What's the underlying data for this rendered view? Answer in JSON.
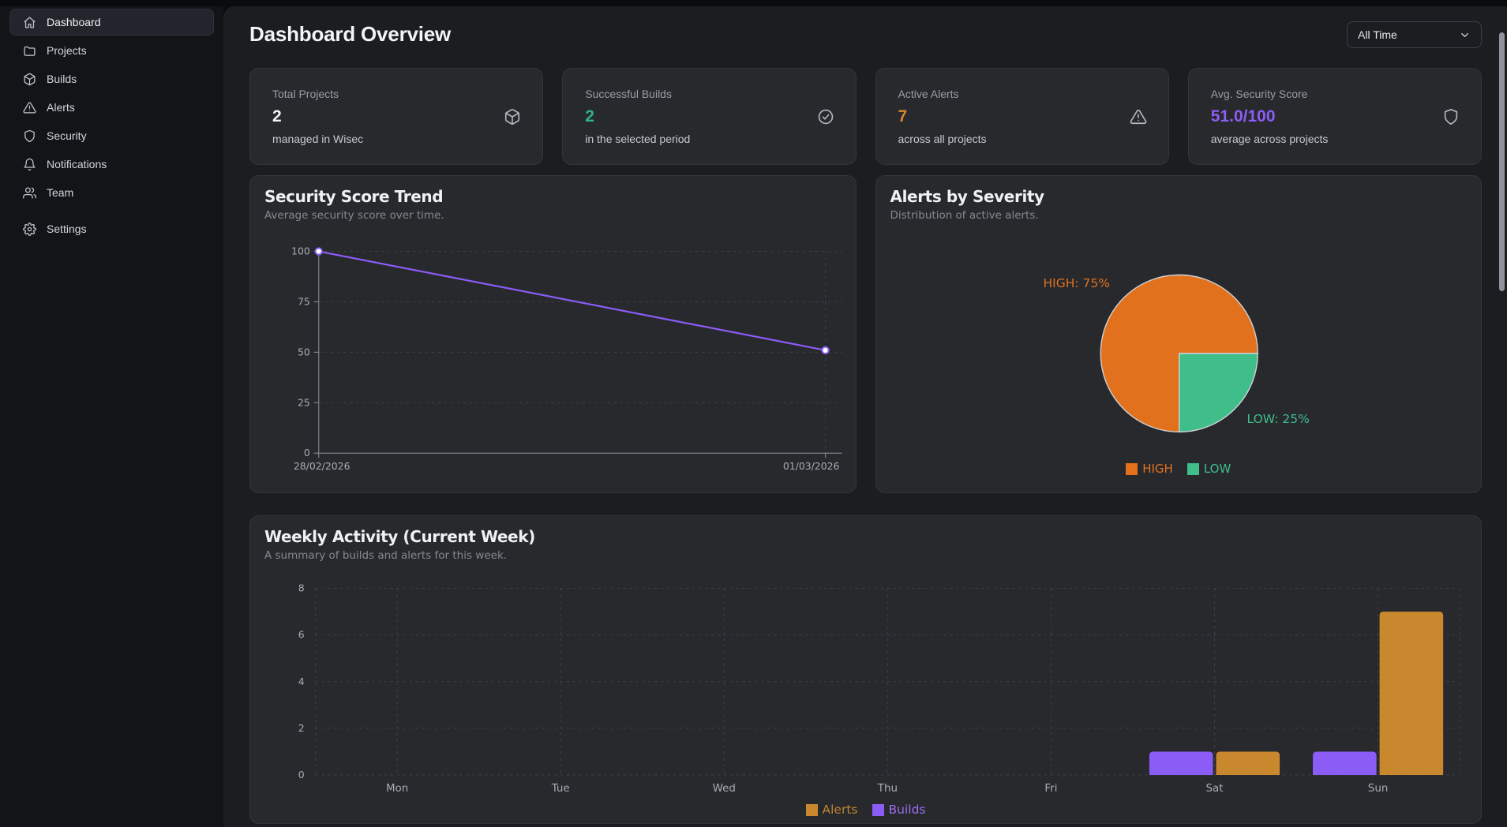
{
  "sidebar": {
    "items": [
      {
        "label": "Dashboard",
        "icon": "home",
        "active": true
      },
      {
        "label": "Projects",
        "icon": "folder",
        "active": false
      },
      {
        "label": "Builds",
        "icon": "package",
        "active": false
      },
      {
        "label": "Alerts",
        "icon": "alert-triangle",
        "active": false
      },
      {
        "label": "Security",
        "icon": "shield",
        "active": false
      },
      {
        "label": "Notifications",
        "icon": "bell",
        "active": false
      },
      {
        "label": "Team",
        "icon": "users",
        "active": false
      }
    ],
    "footer_items": [
      {
        "label": "Settings",
        "icon": "gear"
      }
    ]
  },
  "header": {
    "title": "Dashboard Overview",
    "time_filter": {
      "value": "All Time",
      "icon": "chevron-down"
    }
  },
  "stats": [
    {
      "label": "Total Projects",
      "value": "2",
      "caption": "managed in Wisec",
      "icon": "package",
      "value_color": "#f2f3f5"
    },
    {
      "label": "Successful Builds",
      "value": "2",
      "caption": "in the selected period",
      "icon": "check-circle",
      "value_color": "#2eb584"
    },
    {
      "label": "Active Alerts",
      "value": "7",
      "caption": "across all projects",
      "icon": "alert-triangle",
      "value_color": "#d9872b"
    },
    {
      "label": "Avg. Security Score",
      "value": "51.0/100",
      "caption": "average across projects",
      "icon": "shield",
      "value_color": "#8d5cf6"
    }
  ],
  "chart_data": [
    {
      "type": "line",
      "title": "Security Score Trend",
      "subtitle": "Average security score over time.",
      "x": [
        "28/02/2026",
        "01/03/2026"
      ],
      "series": [
        {
          "name": "Security Score",
          "values": [
            100,
            51
          ],
          "color": "#8b5cf6"
        }
      ],
      "ylim": [
        0,
        100
      ],
      "yticks": [
        0,
        25,
        50,
        75,
        100
      ],
      "grid": "dashed",
      "point_style": {
        "fill": "#ffffff",
        "stroke": "#8b5cf6"
      }
    },
    {
      "type": "pie",
      "title": "Alerts by Severity",
      "subtitle": "Distribution of active alerts.",
      "slices": [
        {
          "label": "HIGH",
          "value": 75,
          "color": "#e2711d",
          "annotation": "HIGH: 75%"
        },
        {
          "label": "LOW",
          "value": 25,
          "color": "#3fbe8a",
          "annotation": "LOW: 25%"
        }
      ],
      "start_angle_deg": 0,
      "direction": "counterclockwise",
      "legend_position": "bottom"
    },
    {
      "type": "bar",
      "title": "Weekly Activity (Current Week)",
      "subtitle": "A summary of builds and alerts for this week.",
      "categories": [
        "Mon",
        "Tue",
        "Wed",
        "Thu",
        "Fri",
        "Sat",
        "Sun"
      ],
      "series": [
        {
          "name": "Builds",
          "values": [
            0,
            0,
            0,
            0,
            0,
            1,
            1
          ],
          "color": "#8b5cf6"
        },
        {
          "name": "Alerts",
          "values": [
            0,
            0,
            0,
            0,
            0,
            1,
            7
          ],
          "color": "#c9882d"
        }
      ],
      "ylim": [
        0,
        8
      ],
      "yticks": [
        0,
        2,
        4,
        6,
        8
      ],
      "grid": "dashed",
      "legend": [
        "Alerts",
        "Builds"
      ],
      "legend_colors": [
        "#c9882d",
        "#8b5cf6"
      ],
      "legend_text_colors": [
        "#c0862f",
        "#9c6ef3"
      ]
    }
  ]
}
